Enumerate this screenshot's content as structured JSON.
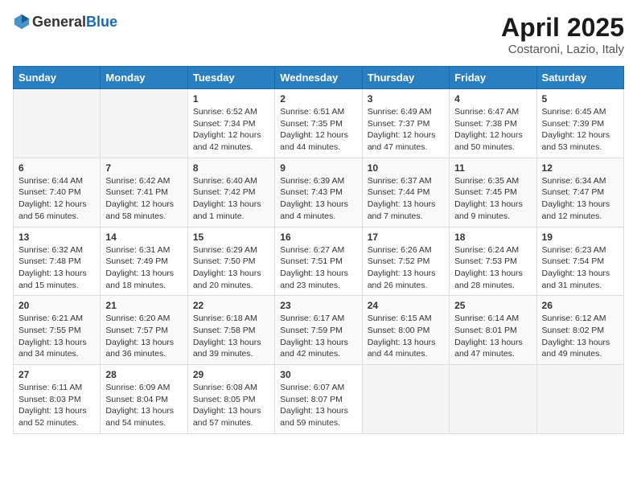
{
  "header": {
    "logo_general": "General",
    "logo_blue": "Blue",
    "month_year": "April 2025",
    "location": "Costaroni, Lazio, Italy"
  },
  "weekdays": [
    "Sunday",
    "Monday",
    "Tuesday",
    "Wednesday",
    "Thursday",
    "Friday",
    "Saturday"
  ],
  "weeks": [
    [
      {
        "day": "",
        "info": ""
      },
      {
        "day": "",
        "info": ""
      },
      {
        "day": "1",
        "info": "Sunrise: 6:52 AM\nSunset: 7:34 PM\nDaylight: 12 hours and 42 minutes."
      },
      {
        "day": "2",
        "info": "Sunrise: 6:51 AM\nSunset: 7:35 PM\nDaylight: 12 hours and 44 minutes."
      },
      {
        "day": "3",
        "info": "Sunrise: 6:49 AM\nSunset: 7:37 PM\nDaylight: 12 hours and 47 minutes."
      },
      {
        "day": "4",
        "info": "Sunrise: 6:47 AM\nSunset: 7:38 PM\nDaylight: 12 hours and 50 minutes."
      },
      {
        "day": "5",
        "info": "Sunrise: 6:45 AM\nSunset: 7:39 PM\nDaylight: 12 hours and 53 minutes."
      }
    ],
    [
      {
        "day": "6",
        "info": "Sunrise: 6:44 AM\nSunset: 7:40 PM\nDaylight: 12 hours and 56 minutes."
      },
      {
        "day": "7",
        "info": "Sunrise: 6:42 AM\nSunset: 7:41 PM\nDaylight: 12 hours and 58 minutes."
      },
      {
        "day": "8",
        "info": "Sunrise: 6:40 AM\nSunset: 7:42 PM\nDaylight: 13 hours and 1 minute."
      },
      {
        "day": "9",
        "info": "Sunrise: 6:39 AM\nSunset: 7:43 PM\nDaylight: 13 hours and 4 minutes."
      },
      {
        "day": "10",
        "info": "Sunrise: 6:37 AM\nSunset: 7:44 PM\nDaylight: 13 hours and 7 minutes."
      },
      {
        "day": "11",
        "info": "Sunrise: 6:35 AM\nSunset: 7:45 PM\nDaylight: 13 hours and 9 minutes."
      },
      {
        "day": "12",
        "info": "Sunrise: 6:34 AM\nSunset: 7:47 PM\nDaylight: 13 hours and 12 minutes."
      }
    ],
    [
      {
        "day": "13",
        "info": "Sunrise: 6:32 AM\nSunset: 7:48 PM\nDaylight: 13 hours and 15 minutes."
      },
      {
        "day": "14",
        "info": "Sunrise: 6:31 AM\nSunset: 7:49 PM\nDaylight: 13 hours and 18 minutes."
      },
      {
        "day": "15",
        "info": "Sunrise: 6:29 AM\nSunset: 7:50 PM\nDaylight: 13 hours and 20 minutes."
      },
      {
        "day": "16",
        "info": "Sunrise: 6:27 AM\nSunset: 7:51 PM\nDaylight: 13 hours and 23 minutes."
      },
      {
        "day": "17",
        "info": "Sunrise: 6:26 AM\nSunset: 7:52 PM\nDaylight: 13 hours and 26 minutes."
      },
      {
        "day": "18",
        "info": "Sunrise: 6:24 AM\nSunset: 7:53 PM\nDaylight: 13 hours and 28 minutes."
      },
      {
        "day": "19",
        "info": "Sunrise: 6:23 AM\nSunset: 7:54 PM\nDaylight: 13 hours and 31 minutes."
      }
    ],
    [
      {
        "day": "20",
        "info": "Sunrise: 6:21 AM\nSunset: 7:55 PM\nDaylight: 13 hours and 34 minutes."
      },
      {
        "day": "21",
        "info": "Sunrise: 6:20 AM\nSunset: 7:57 PM\nDaylight: 13 hours and 36 minutes."
      },
      {
        "day": "22",
        "info": "Sunrise: 6:18 AM\nSunset: 7:58 PM\nDaylight: 13 hours and 39 minutes."
      },
      {
        "day": "23",
        "info": "Sunrise: 6:17 AM\nSunset: 7:59 PM\nDaylight: 13 hours and 42 minutes."
      },
      {
        "day": "24",
        "info": "Sunrise: 6:15 AM\nSunset: 8:00 PM\nDaylight: 13 hours and 44 minutes."
      },
      {
        "day": "25",
        "info": "Sunrise: 6:14 AM\nSunset: 8:01 PM\nDaylight: 13 hours and 47 minutes."
      },
      {
        "day": "26",
        "info": "Sunrise: 6:12 AM\nSunset: 8:02 PM\nDaylight: 13 hours and 49 minutes."
      }
    ],
    [
      {
        "day": "27",
        "info": "Sunrise: 6:11 AM\nSunset: 8:03 PM\nDaylight: 13 hours and 52 minutes."
      },
      {
        "day": "28",
        "info": "Sunrise: 6:09 AM\nSunset: 8:04 PM\nDaylight: 13 hours and 54 minutes."
      },
      {
        "day": "29",
        "info": "Sunrise: 6:08 AM\nSunset: 8:05 PM\nDaylight: 13 hours and 57 minutes."
      },
      {
        "day": "30",
        "info": "Sunrise: 6:07 AM\nSunset: 8:07 PM\nDaylight: 13 hours and 59 minutes."
      },
      {
        "day": "",
        "info": ""
      },
      {
        "day": "",
        "info": ""
      },
      {
        "day": "",
        "info": ""
      }
    ]
  ]
}
